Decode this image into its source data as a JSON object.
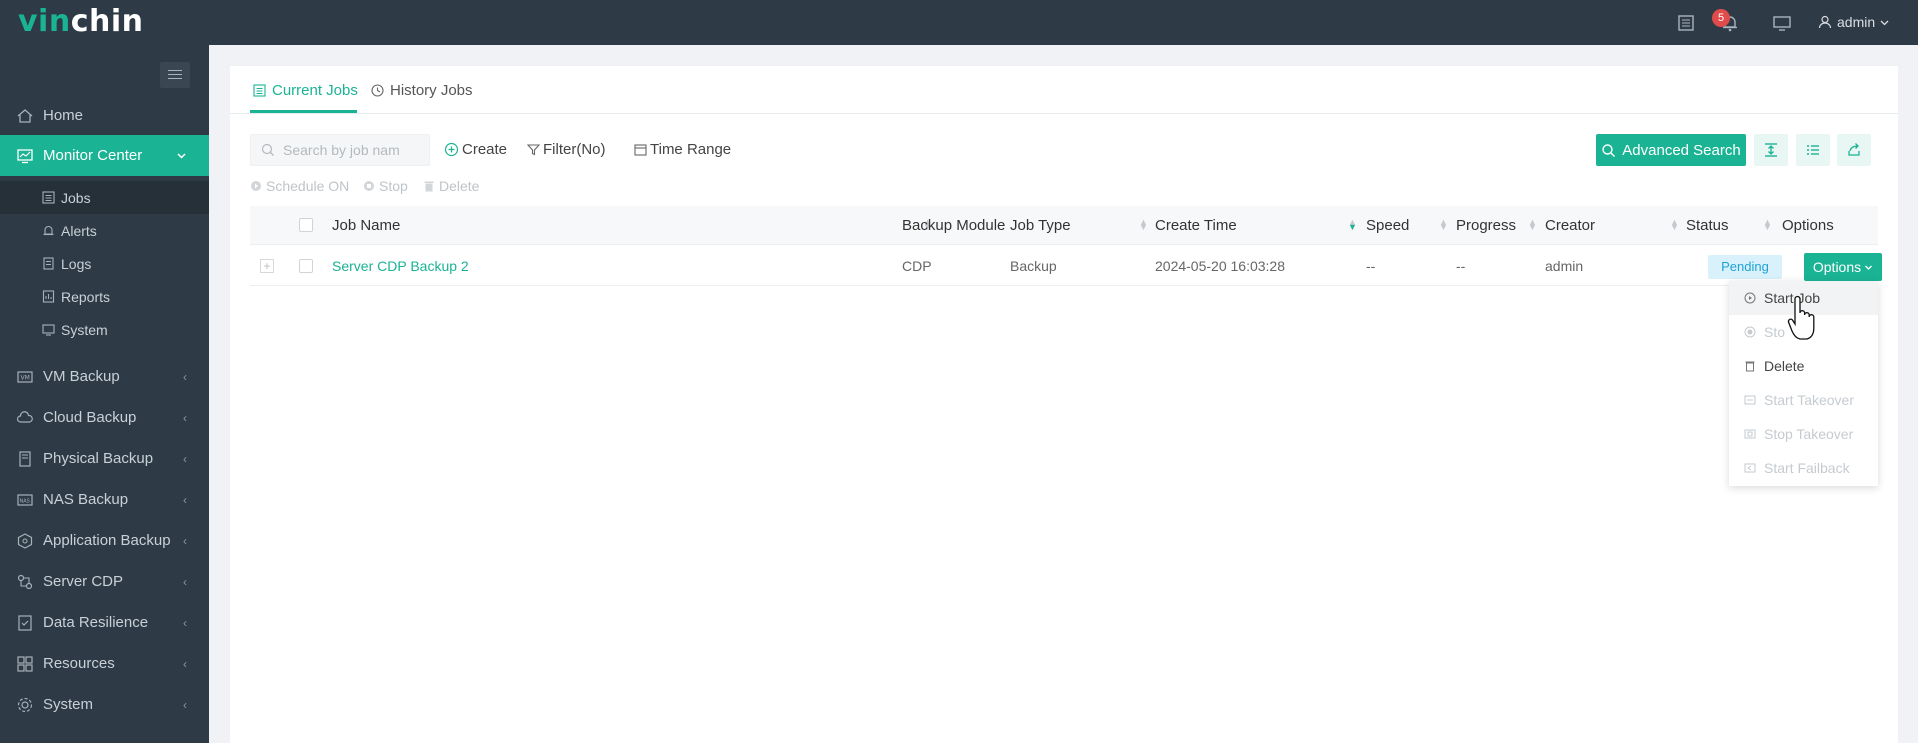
{
  "app": {
    "logo_prefix": "vin",
    "logo_suffix": "chin",
    "notification_count": "5",
    "user": "admin"
  },
  "sidebar": {
    "items": [
      {
        "label": "Home",
        "icon": "home-icon"
      },
      {
        "label": "Monitor Center",
        "icon": "monitor-icon",
        "active": true
      },
      {
        "label": "VM Backup",
        "icon": "vm-icon"
      },
      {
        "label": "Cloud Backup",
        "icon": "cloud-icon"
      },
      {
        "label": "Physical Backup",
        "icon": "physical-icon"
      },
      {
        "label": "NAS Backup",
        "icon": "nas-icon"
      },
      {
        "label": "Application Backup",
        "icon": "application-icon"
      },
      {
        "label": "Server CDP",
        "icon": "server-cdp-icon"
      },
      {
        "label": "Data Resilience",
        "icon": "data-resilience-icon"
      },
      {
        "label": "Resources",
        "icon": "resources-icon"
      },
      {
        "label": "System",
        "icon": "system-icon"
      }
    ],
    "subitems": [
      {
        "label": "Jobs",
        "icon": "jobs-icon",
        "current": true
      },
      {
        "label": "Alerts",
        "icon": "alerts-icon"
      },
      {
        "label": "Logs",
        "icon": "logs-icon"
      },
      {
        "label": "Reports",
        "icon": "reports-icon"
      },
      {
        "label": "System",
        "icon": "system-sub-icon"
      }
    ]
  },
  "tabs": [
    {
      "label": "Current Jobs",
      "active": true
    },
    {
      "label": "History Jobs"
    }
  ],
  "toolbar": {
    "search_placeholder": "Search by job nam",
    "create": "Create",
    "filter": "Filter(No)",
    "time_range": "Time Range",
    "advanced_search": "Advanced Search",
    "schedule_on": "Schedule ON",
    "stop": "Stop",
    "delete": "Delete"
  },
  "table": {
    "columns": [
      "Job Name",
      "Backup Module",
      "Job Type",
      "Create Time",
      "Speed",
      "Progress",
      "Creator",
      "Status",
      "Options"
    ],
    "rows": [
      {
        "job_name": "Server CDP Backup 2",
        "backup_module": "CDP",
        "job_type": "Backup",
        "create_time": "2024-05-20 16:03:28",
        "speed": "--",
        "progress": "--",
        "creator": "admin",
        "status": "Pending",
        "options": "Options"
      }
    ]
  },
  "options_menu": [
    {
      "label": "Start Job",
      "enabled": true
    },
    {
      "label": "Sto",
      "enabled": false
    },
    {
      "label": "Delete",
      "enabled": true
    },
    {
      "label": "Start Takeover",
      "enabled": false
    },
    {
      "label": "Stop Takeover",
      "enabled": false
    },
    {
      "label": "Start Failback",
      "enabled": false
    }
  ],
  "colors": {
    "accent": "#1ab394",
    "sidebar_bg": "#2e3a45",
    "pending_bg": "#d9f1fb",
    "pending_text": "#1fa3d6",
    "badge": "#e04b4b"
  }
}
